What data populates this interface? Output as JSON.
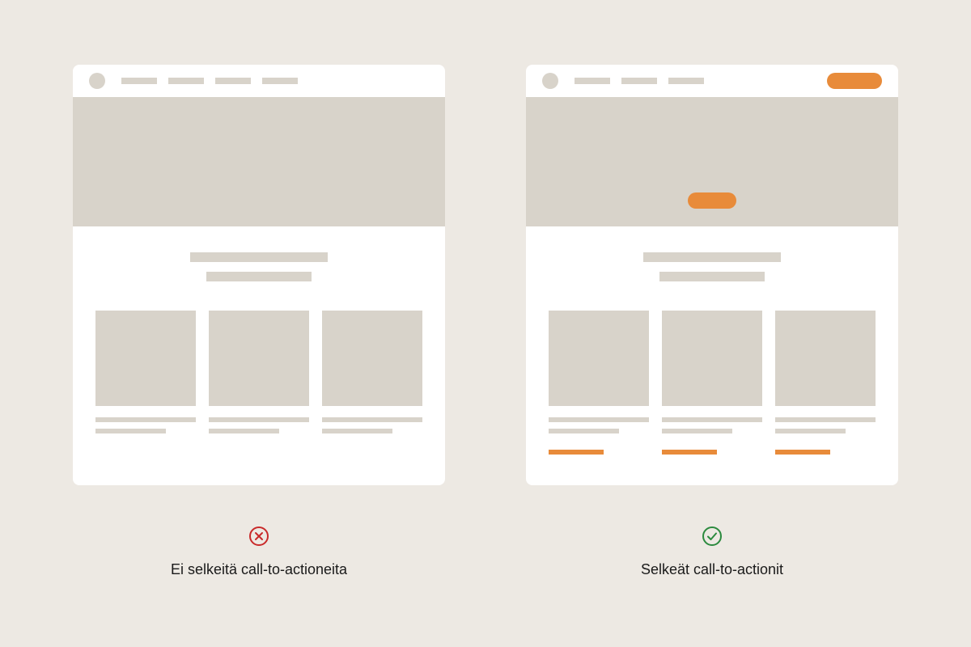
{
  "comparison": {
    "bad": {
      "label": "Ei selkeitä call-to-actioneita",
      "status": "error"
    },
    "good": {
      "label": "Selkeät call-to-actionit",
      "status": "success"
    }
  },
  "colors": {
    "placeholder": "#d8d3ca",
    "cta": "#e88b3a",
    "error": "#c92a2a",
    "success": "#2b8a3e",
    "background": "#ede9e3"
  }
}
